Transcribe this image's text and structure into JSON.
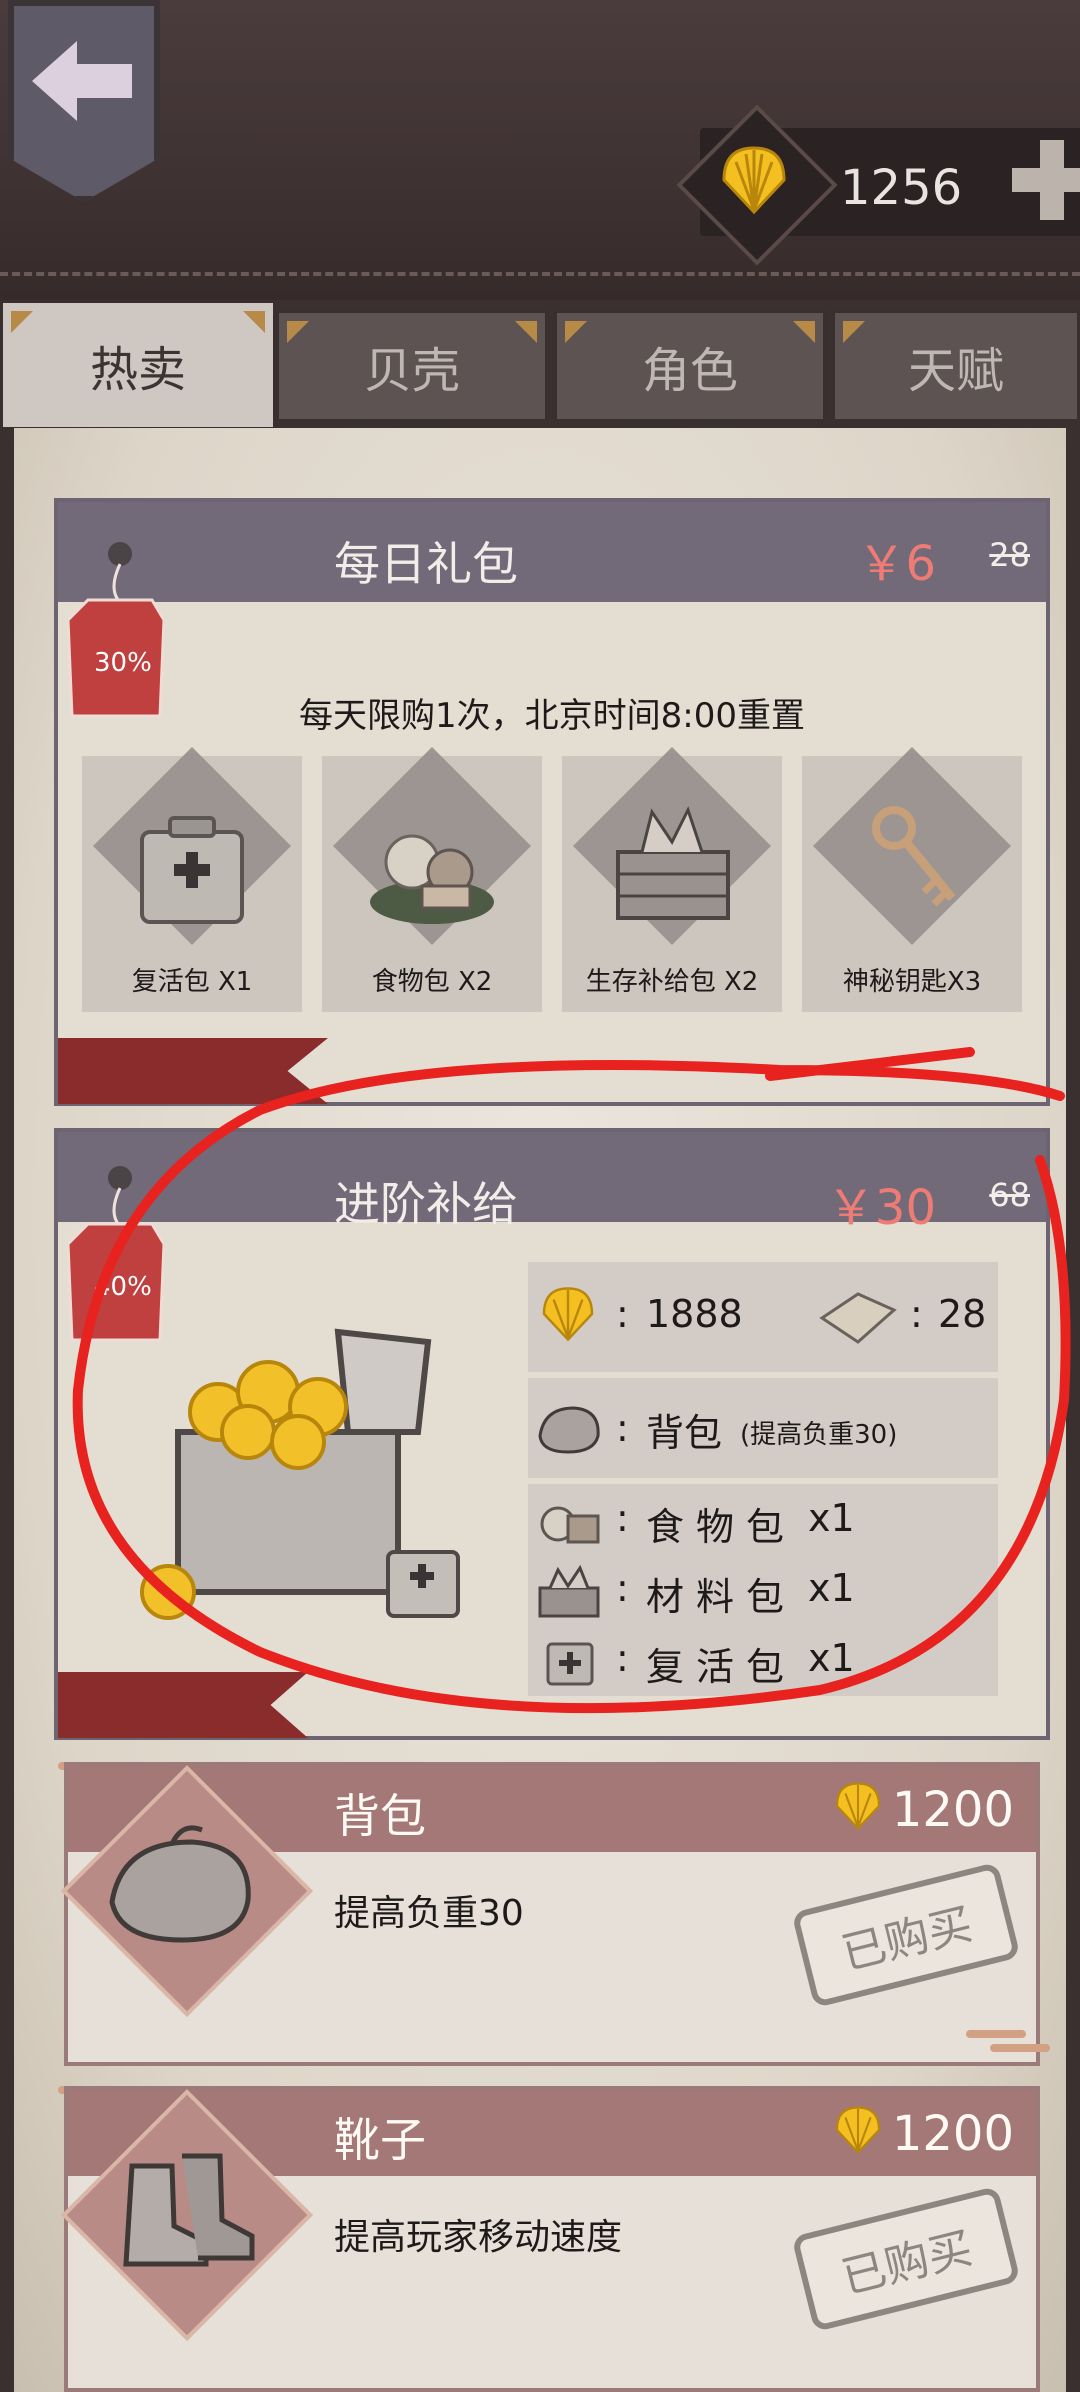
{
  "header": {
    "currency_amount": "1256"
  },
  "tabs": [
    {
      "label": "热卖",
      "active": true
    },
    {
      "label": "贝壳",
      "active": false
    },
    {
      "label": "角色",
      "active": false
    },
    {
      "label": "天赋",
      "active": false
    }
  ],
  "daily_pack": {
    "title": "每日礼包",
    "price": "￥6",
    "original_price": "28",
    "discount": "30%",
    "note": "每天限购1次，北京时间8:00重置",
    "items": [
      {
        "label": "复活包 X1",
        "icon": "revive-kit-icon"
      },
      {
        "label": "食物包 X2",
        "icon": "food-pack-icon"
      },
      {
        "label": "生存补给包 X2",
        "icon": "supply-crate-icon"
      },
      {
        "label": "神秘钥匙X3",
        "icon": "mystery-key-icon"
      }
    ]
  },
  "advanced_pack": {
    "title": "进阶补给",
    "price": "￥30",
    "original_price": "68",
    "discount": "40%",
    "shells": "1888",
    "paper": "28",
    "backpack_label": "背包",
    "backpack_sub": "(提高负重30)",
    "food_label": "食物包",
    "food_qty": "x1",
    "material_label": "材料包",
    "material_qty": "x1",
    "revive_label": "复活包",
    "revive_qty": "x1"
  },
  "shop_items": [
    {
      "name": "背包",
      "desc": "提高负重30",
      "price": "1200",
      "status": "已购买",
      "icon": "backpack-icon"
    },
    {
      "name": "靴子",
      "desc": "提高玩家移动速度",
      "price": "1200",
      "status": "已购买",
      "icon": "boots-icon"
    }
  ],
  "colors": {
    "accent_price": "#ee7c74",
    "header_bg": "#726a78",
    "shop_header": "#a57878",
    "annotation": "#e8221e"
  }
}
